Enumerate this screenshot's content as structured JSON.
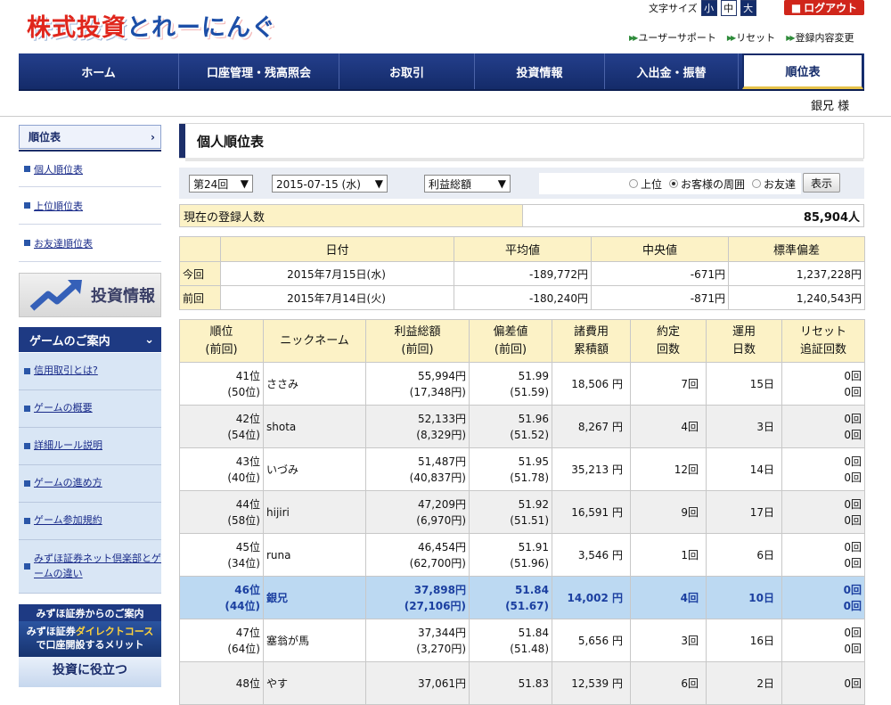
{
  "header": {
    "logo_part1": "株式投資",
    "logo_part2": "とれーにんぐ",
    "font_size_label": "文字サイズ",
    "font_sizes": [
      "小",
      "中",
      "大"
    ],
    "logout_label": "ログアウト",
    "links": [
      "ユーザーサポート",
      "リセット",
      "登録内容変更"
    ]
  },
  "nav": {
    "items": [
      "ホーム",
      "口座管理・残高照会",
      "お取引",
      "投資情報",
      "入出金・振替",
      "順位表"
    ],
    "active": "順位表"
  },
  "user": {
    "name": "銀兄 様"
  },
  "sidebar": {
    "section_title": "順位表",
    "links": [
      "個人順位表",
      "上位順位表",
      "お友達順位表"
    ],
    "banner_text": "投資情報",
    "game_title": "ゲームのご案内",
    "game_links": [
      "信用取引とは?",
      "ゲームの概要",
      "詳細ルール説明",
      "ゲームの進め方",
      "ゲーム参加規約",
      "みずほ証券ネット倶楽部とゲームの違い"
    ],
    "mizuho_title": "みずほ証券からのご案内",
    "mizuho_ad_line1a": "みずほ証券",
    "mizuho_ad_line1b": "ダイレクトコース",
    "mizuho_ad_line2": "で口座開設するメリット",
    "mizuho_ad2": "投資に役立つ"
  },
  "main": {
    "title": "個人順位表",
    "filters": {
      "round": "第24回",
      "date": "2015-07-15 (水)",
      "metric": "利益総額",
      "radio_options": [
        "上位",
        "お客様の周囲",
        "お友達"
      ],
      "radio_selected": "お客様の周囲",
      "show_button": "表示"
    },
    "registered": {
      "label": "現在の登録人数",
      "value": "85,904人"
    },
    "stats": {
      "headers": [
        "",
        "日付",
        "平均値",
        "中央値",
        "標準偏差"
      ],
      "rows": [
        {
          "label": "今回",
          "date": "2015年7月15日(水)",
          "avg": "-189,772円",
          "median": "-671円",
          "sd": "1,237,228円"
        },
        {
          "label": "前回",
          "date": "2015年7月14日(火)",
          "avg": "-180,240円",
          "median": "-871円",
          "sd": "1,240,543円"
        }
      ]
    },
    "ranking": {
      "headers": {
        "rank_1": "順位",
        "rank_2": "(前回)",
        "nick": "ニックネーム",
        "profit_1": "利益総額",
        "profit_2": "(前回)",
        "dev_1": "偏差値",
        "dev_2": "(前回)",
        "cost_1": "諸費用",
        "cost_2": "累積額",
        "trades_1": "約定",
        "trades_2": "回数",
        "days_1": "運用",
        "days_2": "日数",
        "reset_1": "リセット",
        "reset_2": "追証回数"
      },
      "rows": [
        {
          "rank": "41位",
          "prev": "(50位)",
          "nick": "ささみ",
          "profit": "55,994円",
          "profit_prev": "(17,348円)",
          "dev": "51.99",
          "dev_prev": "(51.59)",
          "cost": "18,506 円",
          "trades": "7回",
          "days": "15日",
          "reset": "0回",
          "margin": "0回"
        },
        {
          "rank": "42位",
          "prev": "(54位)",
          "nick": "shota",
          "profit": "52,133円",
          "profit_prev": "(8,329円)",
          "dev": "51.96",
          "dev_prev": "(51.52)",
          "cost": "8,267 円",
          "trades": "4回",
          "days": "3日",
          "reset": "0回",
          "margin": "0回"
        },
        {
          "rank": "43位",
          "prev": "(40位)",
          "nick": "いづみ",
          "profit": "51,487円",
          "profit_prev": "(40,837円)",
          "dev": "51.95",
          "dev_prev": "(51.78)",
          "cost": "35,213 円",
          "trades": "12回",
          "days": "14日",
          "reset": "0回",
          "margin": "0回"
        },
        {
          "rank": "44位",
          "prev": "(58位)",
          "nick": "hijiri",
          "profit": "47,209円",
          "profit_prev": "(6,970円)",
          "dev": "51.92",
          "dev_prev": "(51.51)",
          "cost": "16,591 円",
          "trades": "9回",
          "days": "17日",
          "reset": "0回",
          "margin": "0回"
        },
        {
          "rank": "45位",
          "prev": "(34位)",
          "nick": "runa",
          "profit": "46,454円",
          "profit_prev": "(62,700円)",
          "dev": "51.91",
          "dev_prev": "(51.96)",
          "cost": "3,546 円",
          "trades": "1回",
          "days": "6日",
          "reset": "0回",
          "margin": "0回"
        },
        {
          "rank": "46位",
          "prev": "(44位)",
          "nick": "銀兄",
          "profit": "37,898円",
          "profit_prev": "(27,106円)",
          "dev": "51.84",
          "dev_prev": "(51.67)",
          "cost": "14,002 円",
          "trades": "4回",
          "days": "10日",
          "reset": "0回",
          "margin": "0回"
        },
        {
          "rank": "47位",
          "prev": "(64位)",
          "nick": "塞翁が馬",
          "profit": "37,344円",
          "profit_prev": "(3,270円)",
          "dev": "51.84",
          "dev_prev": "(51.48)",
          "cost": "5,656 円",
          "trades": "3回",
          "days": "16日",
          "reset": "0回",
          "margin": "0回"
        },
        {
          "rank": "48位",
          "prev": "",
          "nick": "やす",
          "profit": "37,061円",
          "profit_prev": "",
          "dev": "51.83",
          "dev_prev": "",
          "cost": "12,539 円",
          "trades": "6回",
          "days": "2日",
          "reset": "0回",
          "margin": ""
        }
      ],
      "highlight_row": 5
    }
  },
  "colors": {
    "navy": "#142b69",
    "logout_red": "#d0261b",
    "header_yellow": "#fcf2c6",
    "highlight_blue": "#bcd9f2"
  }
}
